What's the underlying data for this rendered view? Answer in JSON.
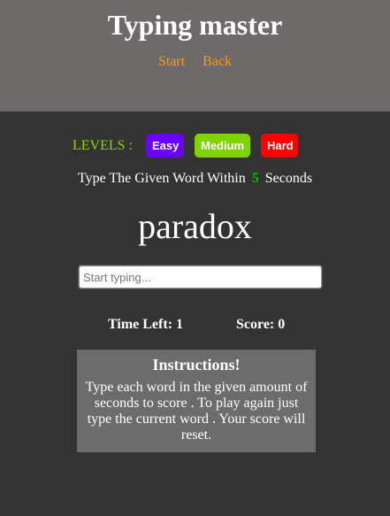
{
  "header": {
    "title": "Typing master",
    "nav": {
      "start": "Start",
      "back": "Back"
    }
  },
  "levels": {
    "label": "LEVELS :",
    "options": [
      {
        "label": "Easy",
        "color": "#6a00ff"
      },
      {
        "label": "Medium",
        "color": "#7ed300"
      },
      {
        "label": "Hard",
        "color": "#ff0000"
      }
    ]
  },
  "prompt": {
    "before": "Type The Given Word Within",
    "seconds": "5",
    "after": "Seconds"
  },
  "current_word": "paradox",
  "input": {
    "value": "",
    "placeholder": "Start typing..."
  },
  "stats": {
    "time_left": "Time Left: 1",
    "score": "Score: 0"
  },
  "instructions": {
    "title": "Instructions!",
    "text": "Type each word in the given amount of seconds to score . To play again just type the current word . Your score will reset."
  },
  "colors": {
    "header_bg": "#6f6a6a",
    "body_bg": "#333333",
    "nav_link": "#ff9a00",
    "levels_label": "#8fd400",
    "seconds_highlight": "#00c000",
    "instructions_bg": "#6c6c6c"
  }
}
